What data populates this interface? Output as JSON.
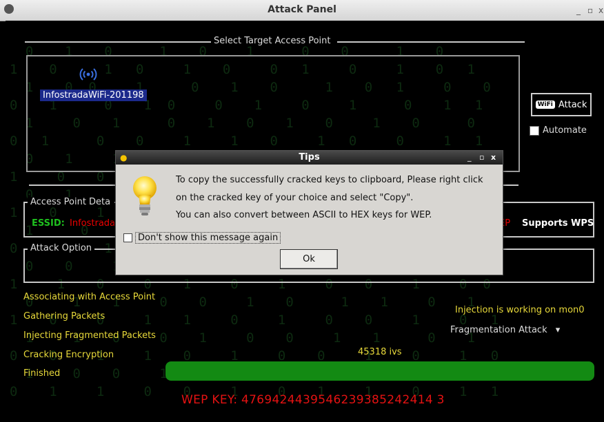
{
  "window": {
    "title": "Attack Panel",
    "controls": [
      "_",
      "▫",
      "x"
    ]
  },
  "target_section": {
    "legend": "Select Target Access Point",
    "access_point": "InfostradaWiFi-201198"
  },
  "attack_button": {
    "badge": "WiFi",
    "label": "Attack"
  },
  "automate": {
    "label": "Automate",
    "checked": false
  },
  "details_section": {
    "legend": "Access Point Deta",
    "essid_label": "ESSID:",
    "essid_value": "Infostrada",
    "encryption_tag": "EP",
    "wps_label": "Supports WPS"
  },
  "options_section": {
    "legend": "Attack Option"
  },
  "steps": [
    "Associating with Access Point",
    "Gathering Packets",
    "Injecting Fragmented Packets",
    "Cracking Encryption",
    "Finished"
  ],
  "injection_status": "Injection is working on mon0",
  "attack_type": {
    "selected": "Fragmentation Attack",
    "arrow": "▾"
  },
  "ivs_count": "45318 ivs",
  "progress": 1.0,
  "wep_key": "WEP KEY: 4769424439546239385242414 3",
  "dialog": {
    "title": "Tips",
    "controls": [
      "_",
      "▫",
      "x"
    ],
    "lines": [
      "To copy the successfully cracked keys to clipboard, Please right click",
      "on the cracked key of your choice and select \"Copy\".",
      "You can also convert between ASCII to HEX keys for WEP."
    ],
    "dont_show_label": "Don't show this message again",
    "ok_label": "Ok"
  },
  "colors": {
    "status_yellow": "#e8d93a",
    "key_red": "#e51212",
    "progress_green": "#138a13",
    "essid_green": "#1ec01e"
  }
}
